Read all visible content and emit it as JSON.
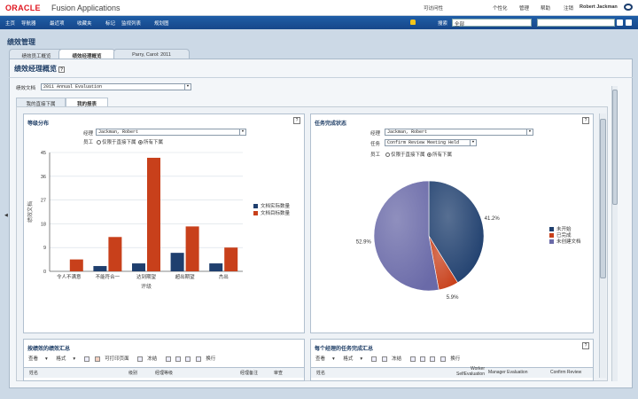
{
  "app": {
    "logo": "ORACLE",
    "name": "Fusion Applications"
  },
  "top_links": {
    "accessibility": "可访问性",
    "personalize": "个性化",
    "manage": "管理",
    "help": "帮助",
    "signout": "注销",
    "user": "Robert Jackman"
  },
  "nav": {
    "items": [
      "主页",
      "导航器",
      "最近项",
      "收藏夹",
      "标记",
      "监视列表",
      "规划图"
    ],
    "search_label": "搜索",
    "search_scope": "全部",
    "search_placeholder": ""
  },
  "page": {
    "title": "绩效管理"
  },
  "tabs": [
    "绩效员工概览",
    "绩效经理概览",
    "Parry, Carol: 2011"
  ],
  "panel": {
    "title": "绩效经理概览",
    "doc_label": "绩效文档",
    "doc_value": "2011 Annual Evaluation"
  },
  "subtabs": [
    "我的直接下属",
    "我的报表"
  ],
  "rating_card": {
    "title": "等级分布",
    "manager_label": "经理",
    "manager_value": "Jackman, Robert",
    "worker_label": "员工",
    "opt_direct": "仅限于直接下属",
    "opt_all": "所有下属"
  },
  "task_card": {
    "title": "任务完成状态",
    "manager_label": "经理",
    "manager_value": "Jackman, Robert",
    "task_label": "任务",
    "task_value": "Confirm Review Meeting Held",
    "worker_label": "员工",
    "opt_direct": "仅限于直接下属",
    "opt_all": "所有下属"
  },
  "bottom_left": {
    "title": "按绩效的绩效汇总",
    "toolbar": [
      "查看",
      "格式",
      "可打印页面",
      "冻结",
      "换行"
    ],
    "columns": [
      "姓名",
      "级别",
      "经理等级",
      "经理备注",
      "审查"
    ]
  },
  "bottom_right": {
    "title": "每个经理的任务完成汇总",
    "toolbar": [
      "查看",
      "格式",
      "冻结",
      "换行"
    ],
    "columns": [
      "姓名",
      "Worker SelfEvaluation",
      "Manager Evaluation",
      "Confirm Review"
    ]
  },
  "chart_data": [
    {
      "type": "bar",
      "title": "",
      "xlabel": "评级",
      "ylabel": "绩效文档",
      "ylim": [
        0,
        45
      ],
      "yticks": [
        0,
        9,
        18,
        27,
        36,
        45
      ],
      "categories": [
        "令人不满意",
        "不能符合一",
        "达到期望",
        "超出期望",
        "杰出"
      ],
      "series": [
        {
          "name": "文档实际数量",
          "color": "#1f3f6e",
          "values": [
            0,
            2,
            3,
            7,
            3
          ]
        },
        {
          "name": "文档目标数量",
          "color": "#c8401b",
          "values": [
            4.5,
            13,
            43,
            17,
            9
          ]
        }
      ],
      "legend": "right",
      "grid": true
    },
    {
      "type": "pie",
      "series": [
        {
          "name": "未开始",
          "color": "#1f3f6e",
          "value": 41.2,
          "label": "41.2%"
        },
        {
          "name": "已完成",
          "color": "#c8401b",
          "value": 5.9,
          "label": "5.9%"
        },
        {
          "name": "未创建文档",
          "color": "#6a6aa8",
          "value": 52.9,
          "label": "52.9%"
        }
      ],
      "legend": "right"
    }
  ],
  "colors": {
    "nav": "#1f5ea7",
    "accent": "#e0161f"
  }
}
